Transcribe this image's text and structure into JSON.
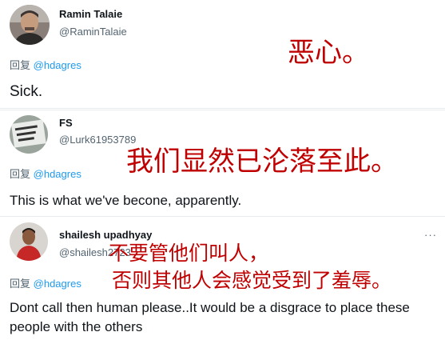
{
  "tweets": [
    {
      "display_name": "Ramin Talaie",
      "handle": "@RaminTalaie",
      "reply_prefix": "回复",
      "reply_to": "@hdagres",
      "text": "Sick.",
      "translation": "恶心。"
    },
    {
      "display_name": "FS",
      "handle": "@Lurk61953789",
      "reply_prefix": "回复",
      "reply_to": "@hdagres",
      "text": "This is what we've becone, apparently.",
      "translation": "我们显然已沦落至此。"
    },
    {
      "display_name": "shailesh upadhyay",
      "handle": "@shailesh2723",
      "reply_prefix": "回复",
      "reply_to": "@hdagres",
      "text": "Dont call then human please..It would be a disgrace to place these people with the others",
      "translation_line1": "不要管他们叫人，",
      "translation_line2": "否则其他人会感觉受到了羞辱。",
      "more_icon": "···"
    }
  ]
}
